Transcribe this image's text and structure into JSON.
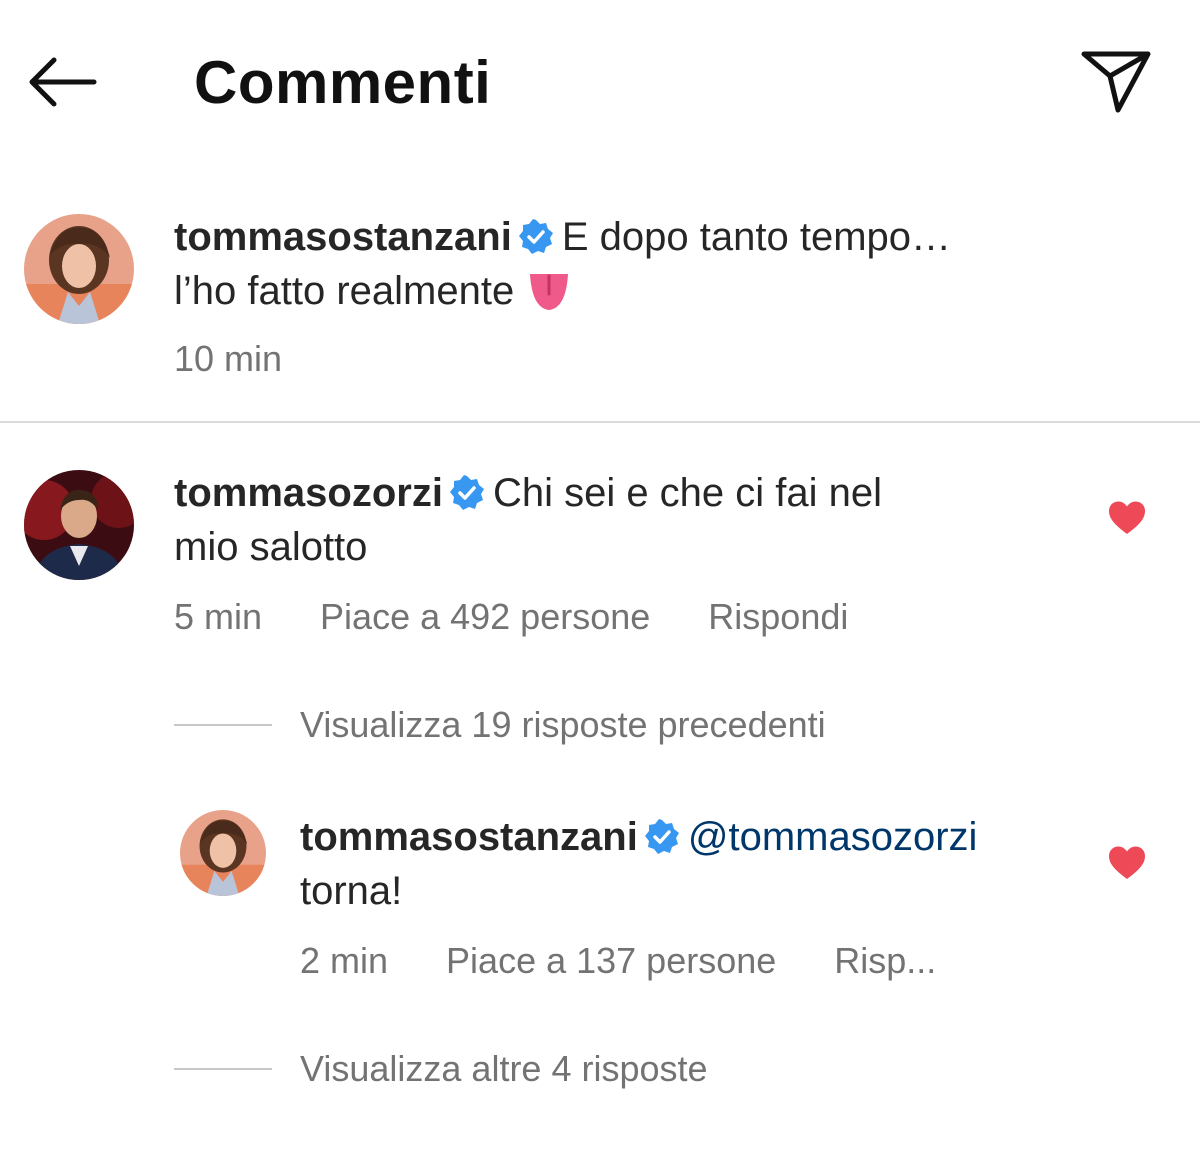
{
  "header": {
    "title": "Commenti",
    "back_icon": "arrow-left-icon",
    "send_icon": "paper-plane-icon"
  },
  "caption": {
    "username": "tommasostanzani",
    "text_line1": "E dopo tanto tempo…",
    "text_line2": "l’ho fatto realmente",
    "emoji": "tongue-emoji",
    "time": "10 min"
  },
  "comment": {
    "username": "tommasozorzi",
    "text": "Chi sei e che ci fai nel",
    "text_line2": "mio salotto",
    "time": "5 min",
    "likes": "Piace a 492 persone",
    "reply": "Rispondi",
    "liked": true
  },
  "view_previous": "Visualizza 19 risposte precedenti",
  "reply": {
    "username": "tommasostanzani",
    "mention": "@tommasozorzi",
    "text_line2": "torna!",
    "time": "2 min",
    "likes": "Piace a 137 persone",
    "reply": "Risp...",
    "liked": true
  },
  "view_more": "Visualizza altre 4 risposte",
  "colors": {
    "verified_blue": "#3897f0",
    "heart_red": "#ed4956",
    "mention_blue": "#00376b",
    "secondary_text": "#737373"
  }
}
